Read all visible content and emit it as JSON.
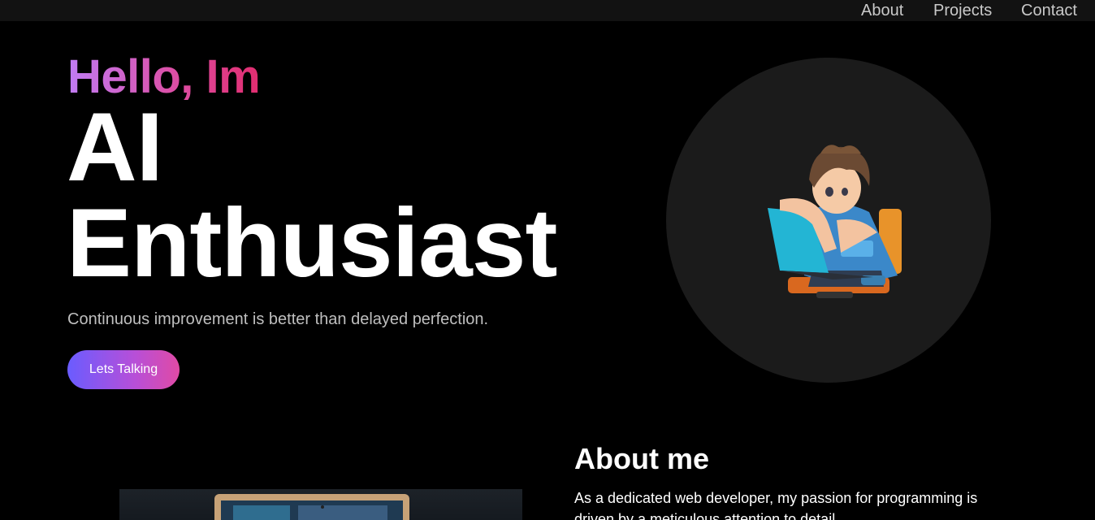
{
  "nav": {
    "about": "About",
    "projects": "Projects",
    "contact": "Contact"
  },
  "hero": {
    "greeting": "Hello, Im",
    "title_line1": "AI",
    "title_line2": "Enthusiast",
    "tagline": "Continuous improvement is better than delayed perfection.",
    "cta_label": "Lets Talking",
    "avatar_icon": "boy-with-laptop-illustration"
  },
  "about": {
    "heading": "About me",
    "text": "As a dedicated web developer, my passion for programming is driven by a meticulous attention to detail."
  },
  "colors": {
    "background": "#000000",
    "nav_background": "#121212",
    "accent_purple": "#c07cf4",
    "accent_pink": "#e12d6f",
    "cta_start": "#6a5cff",
    "cta_end": "#e04aa5",
    "avatar_circle": "#1b1b1b"
  }
}
